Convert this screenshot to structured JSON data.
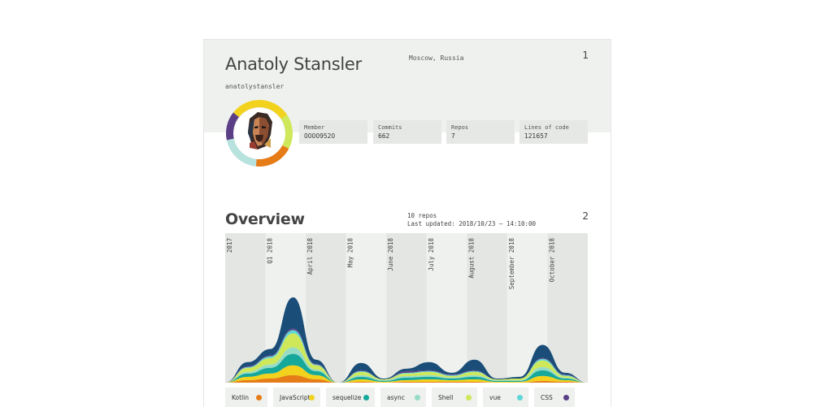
{
  "profile": {
    "name": "Anatoly Stansler",
    "location": "Moscow, Russia",
    "username": "anatolystansler",
    "page_number": "1"
  },
  "stats": [
    {
      "label": "Member",
      "value": "00009520"
    },
    {
      "label": "Commits",
      "value": "662"
    },
    {
      "label": "Repos",
      "value": "7"
    },
    {
      "label": "Lines of code",
      "value": "121657"
    }
  ],
  "avatar_ring": [
    {
      "color": "#f2d21c",
      "share": 0.3
    },
    {
      "color": "#cfe85a",
      "share": 0.17
    },
    {
      "color": "#e57c17",
      "share": 0.19
    },
    {
      "color": "#b7e2dd",
      "share": 0.2
    },
    {
      "color": "#5b3f86",
      "share": 0.14
    }
  ],
  "overview": {
    "title": "Overview",
    "repos_count": "10 repos",
    "last_updated": "Last updated: 2018/10/23 — 14:10:00",
    "page_number": "2"
  },
  "chart_data": {
    "type": "area",
    "x_labels": [
      "2017",
      "Q1 2018",
      "April 2018",
      "May 2018",
      "June 2018",
      "July 2018",
      "August 2018",
      "September 2018",
      "October 2018"
    ],
    "x": [
      "2017",
      "Q1 2018",
      "",
      "April 2018",
      "",
      "May 2018",
      "",
      "June 2018",
      "",
      "July 2018",
      "",
      "August 2018",
      "",
      "September 2018",
      "",
      "October 2018",
      ""
    ],
    "series": [
      {
        "name": "Kotlin",
        "color": "#e57c17",
        "values": [
          0,
          3,
          5,
          9,
          4,
          0,
          1,
          0,
          1,
          1,
          1,
          1,
          0,
          0,
          2,
          1,
          0
        ]
      },
      {
        "name": "JavaScript",
        "color": "#f2d21c",
        "values": [
          0,
          4,
          6,
          12,
          5,
          0,
          3,
          1,
          2,
          3,
          2,
          3,
          1,
          1,
          6,
          2,
          0
        ]
      },
      {
        "name": "sequelize",
        "color": "#16a89a",
        "values": [
          0,
          4,
          7,
          14,
          5,
          0,
          3,
          1,
          3,
          3,
          2,
          3,
          1,
          1,
          7,
          2,
          0
        ]
      },
      {
        "name": "async",
        "color": "#97dcc7",
        "values": [
          0,
          2,
          4,
          8,
          2,
          0,
          2,
          1,
          2,
          2,
          1,
          2,
          1,
          1,
          4,
          1,
          0
        ]
      },
      {
        "name": "Shell",
        "color": "#cfe85a",
        "values": [
          0,
          5,
          8,
          17,
          5,
          0,
          4,
          1,
          3,
          4,
          2,
          4,
          1,
          2,
          8,
          2,
          0
        ]
      },
      {
        "name": "vue",
        "color": "#5fd6d8",
        "values": [
          0,
          1,
          2,
          4,
          1,
          0,
          1,
          0,
          1,
          1,
          1,
          1,
          0,
          0,
          2,
          1,
          0
        ]
      },
      {
        "name": "CSS",
        "color": "#5b3f86",
        "values": [
          0,
          1,
          1,
          2,
          1,
          0,
          1,
          0,
          2,
          1,
          1,
          1,
          0,
          0,
          1,
          1,
          0
        ]
      },
      {
        "name": "",
        "color": "#1a4d78",
        "values": [
          0,
          5,
          8,
          38,
          5,
          0,
          9,
          1,
          3,
          10,
          2,
          13,
          1,
          2,
          16,
          2,
          0
        ]
      }
    ],
    "grid": true,
    "legend": "bottom"
  }
}
